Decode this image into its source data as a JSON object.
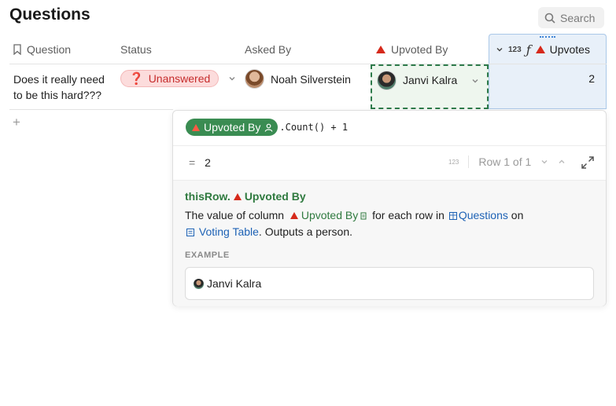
{
  "page": {
    "title": "Questions"
  },
  "search": {
    "label": "Search"
  },
  "columns": {
    "question": "Question",
    "status": "Status",
    "asked_by": "Asked By",
    "upvoted_by": "Upvoted By",
    "upvotes": "Upvotes",
    "upvotes_type": "123",
    "upvotes_formula_glyph": "ƒ"
  },
  "row": {
    "question": "Does it really need to be this hard???",
    "status_icon": "❓",
    "status": "Unanswered",
    "asked_by": "Noah Silverstein",
    "upvoted_by": "Janvi Kalra",
    "upvotes": "2"
  },
  "add_row": {
    "label": "+"
  },
  "formula": {
    "chip_label": "Upvoted By",
    "expression": ".Count() + 1",
    "result_eq": "=",
    "result_value": "2",
    "type_badge": "123",
    "row_nav": "Row 1 of 1"
  },
  "doc": {
    "title_prefix": "thisRow.",
    "title_column": "Upvoted By",
    "desc_pre": "The value of column",
    "desc_column": "Upvoted By",
    "desc_mid": "for each row in",
    "desc_table": "Questions",
    "desc_on": "on",
    "desc_page": "Voting Table",
    "desc_post": ". Outputs a person.",
    "example_label": "EXAMPLE",
    "example_value": "Janvi Kalra"
  },
  "colors": {
    "accent_red": "#d6291b",
    "chip_green": "#3a8c52",
    "link_blue": "#1d62b5",
    "selection_blue": "#e8f0f9"
  },
  "icons": {
    "search": "search-icon",
    "bookmark": "bookmark-icon",
    "chevron": "chevron-down-icon",
    "expand": "expand-icon",
    "person": "person-icon",
    "table": "table-icon",
    "page": "page-icon"
  }
}
